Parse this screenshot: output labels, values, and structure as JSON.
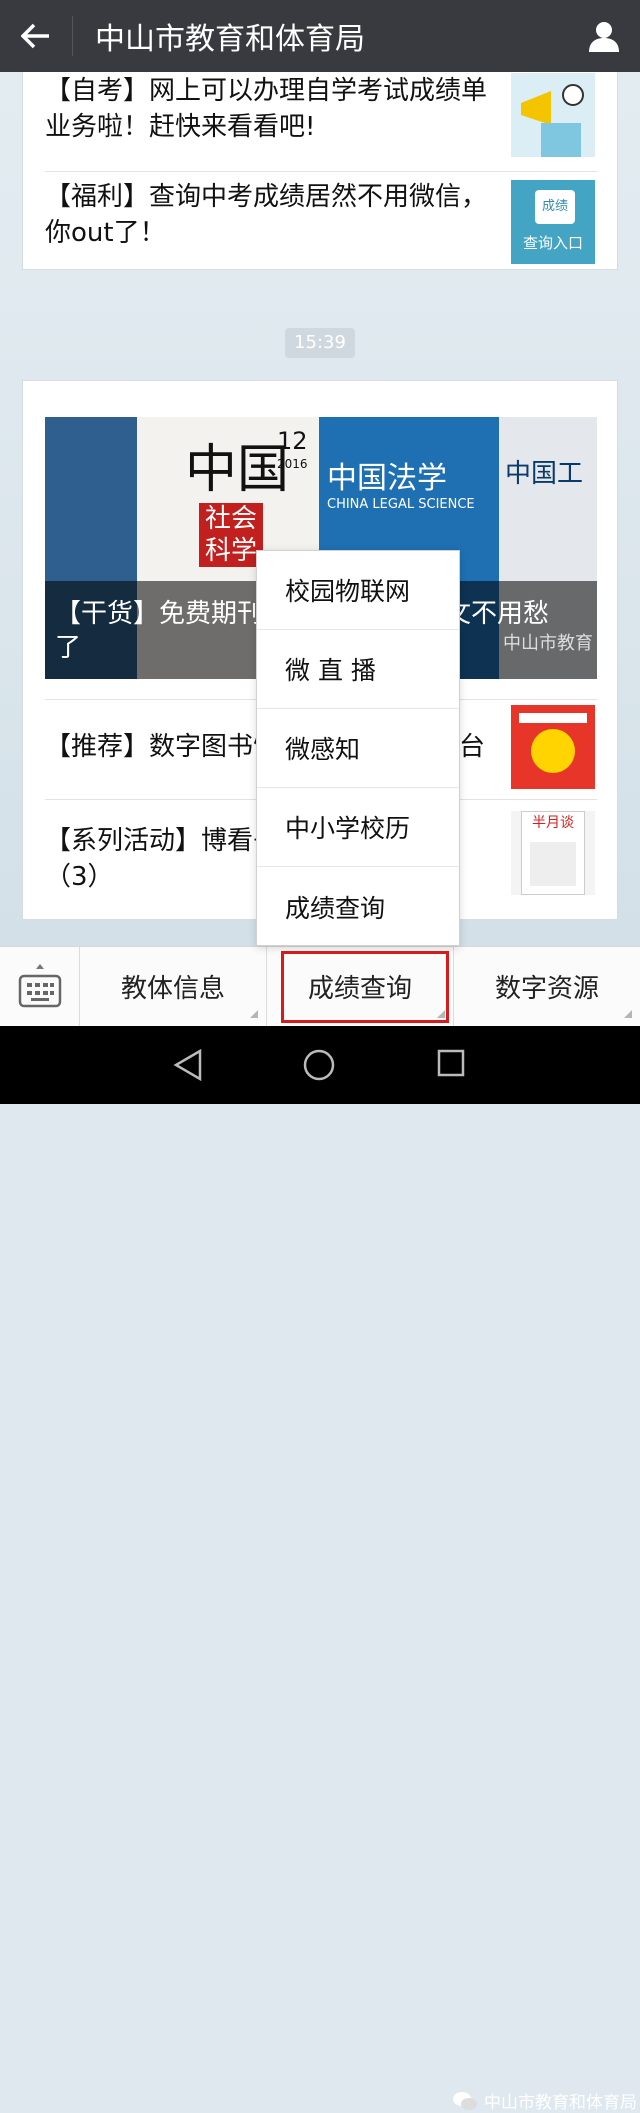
{
  "header": {
    "back_icon": "arrow-left-icon",
    "title": "中山市教育和体育局",
    "profile_icon": "person-icon"
  },
  "articles_top": [
    {
      "text": "【自考】网上可以办理自学考试成绩单业务啦！赶快来看看吧!",
      "thumb_icon": "cartoon-megaphone-image"
    },
    {
      "text": "【福利】查询中考成绩居然不用微信，你out了！",
      "thumb_icon": "query-entry-image",
      "thumb_label": "成绩",
      "thumb_label2": "查询入口"
    }
  ],
  "timestamp": "15:39",
  "featured": {
    "cover_title": "【干货】免费期刊全文下载，写论文不用愁了",
    "cover_journals": [
      "中国",
      "社会科学",
      "12",
      "2016",
      "中国法学",
      "CHINA LEGAL SCIENCE",
      "中国工"
    ],
    "watermark": "中山市教育"
  },
  "articles_bottom": [
    {
      "text": "【推荐】数字图书馆：",
      "text_right": "台",
      "thumb_icon": "library-poster-image"
    },
    {
      "text": "【系列活动】博看书",
      "text2": "（3）",
      "thumb_icon": "magazine-cover-image",
      "thumb_label": "半月谈"
    }
  ],
  "popup_menu": [
    "校园物联网",
    "微 直 播",
    "微感知",
    "中小学校历",
    "成绩查询"
  ],
  "menubar": {
    "keyboard_icon": "keyboard-icon",
    "items": [
      "教体信息",
      "成绩查询",
      "数字资源"
    ]
  },
  "navbar": {
    "back_icon": "triangle-back-icon",
    "home_icon": "circle-home-icon",
    "recent_icon": "square-recent-icon"
  },
  "footer_watermark": "中山市教育和体育局",
  "colors": {
    "topbar": "#393a3f",
    "highlight": "#d41c1c"
  }
}
